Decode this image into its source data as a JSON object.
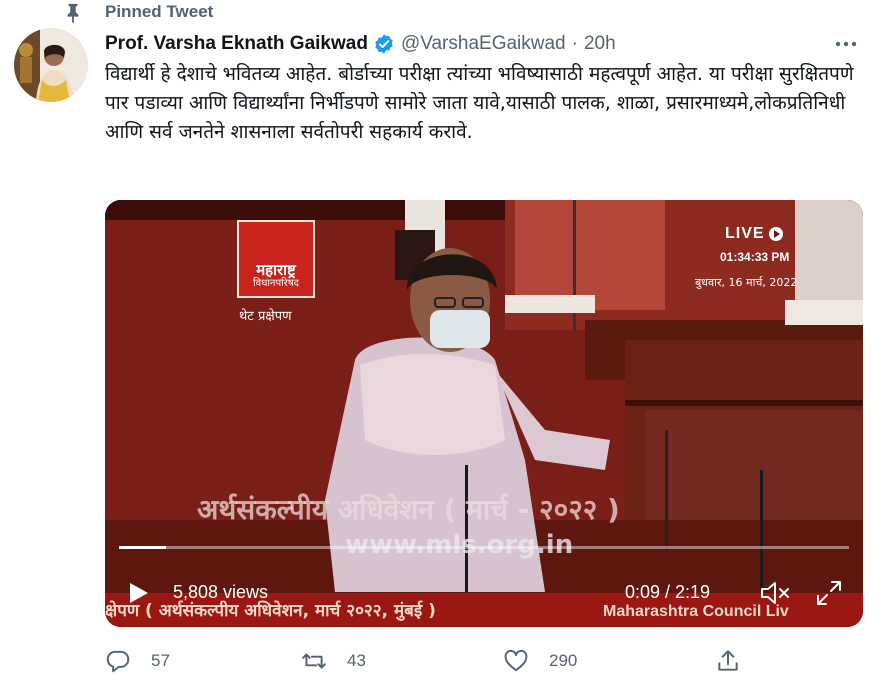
{
  "pinned": {
    "label": "Pinned Tweet"
  },
  "tweet": {
    "display_name": "Prof. Varsha Eknath Gaikwad",
    "handle": "@VarshaEGaikwad",
    "separator": "·",
    "time": "20h",
    "text": "विद्यार्थी हे देशाचे भवितव्य आहेत. बोर्डाच्या परीक्षा त्यांच्या भविष्यासाठी महत्वपूर्ण आहेत. या परीक्षा सुरक्षितपणे पार पडाव्या आणि विद्यार्थ्यांना निर्भीडपणे सामोरे जाता यावे,यासाठी पालक, शाळा, प्रसारमाध्यमे,लोकप्रतिनिधी आणि सर्व जनतेने शासनाला सर्वतोपरी सहकार्य करावे."
  },
  "video": {
    "logo_title": "महाराष्ट्र",
    "logo_subtitle": "विधानपरिषद",
    "logo_caption": "थेट प्रक्षेपण",
    "live_label": "LIVE",
    "live_time": "01:34:33 PM",
    "live_date": "बुधवार, 16 मार्च, 2022",
    "watermark_session": "अर्थसंकल्पीय अधिवेशन ( मार्च - २०२२ )",
    "watermark_url": "www.mls.org.in",
    "ticker_left": "क्षेपण ( अर्थसंकल्पीय अधिवेशन, मार्च २०२२, मुंबई )",
    "ticker_right": "Maharashtra Council Liv",
    "views": "5,808 views",
    "duration": "0:09 / 2:19",
    "progress": 0.065
  },
  "actions": {
    "reply_count": "57",
    "retweet_count": "43",
    "like_count": "290"
  },
  "colors": {
    "verified": "#1d9bf0",
    "secondary_text": "#536471",
    "media_red": "#9b1711"
  },
  "icons": [
    "pin-icon",
    "verified-icon",
    "more-icon",
    "play-icon",
    "mute-icon",
    "fullscreen-icon",
    "reply-icon",
    "retweet-icon",
    "like-icon",
    "share-icon"
  ]
}
